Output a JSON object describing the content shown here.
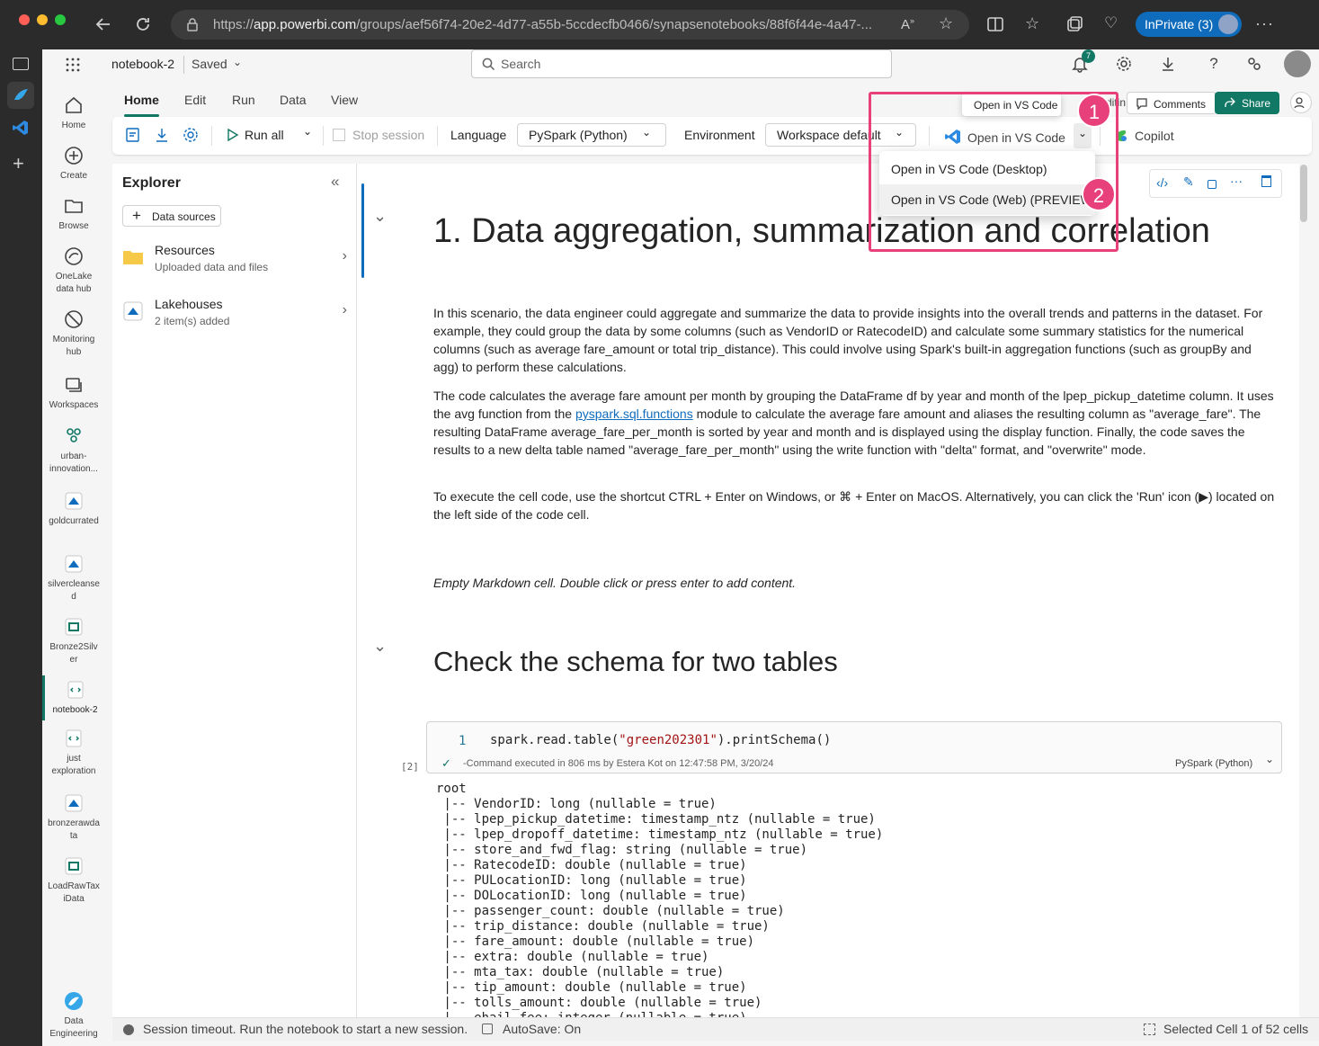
{
  "browser": {
    "url_prefix": "https://",
    "url_host": "app.powerbi.com",
    "url_path": "/groups/aef56f74-20e2-4d77-a55b-5ccdecfb0466/synapsenotebooks/88f6f44e-4a47-...",
    "inprivate_label": "InPrivate (3)"
  },
  "topbar": {
    "notebook_name": "notebook-2",
    "saved_label": "Saved",
    "search_placeholder": "Search",
    "notification_count": "7"
  },
  "nav": {
    "items": [
      {
        "label": "Home"
      },
      {
        "label": "Create"
      },
      {
        "label": "Browse"
      },
      {
        "label": "OneLake data hub"
      },
      {
        "label": "Monitoring hub"
      },
      {
        "label": "Workspaces"
      },
      {
        "label": "urban-innovation..."
      },
      {
        "label": "goldcurrated"
      },
      {
        "label": "silvercleansed"
      },
      {
        "label": "Bronze2Silver"
      },
      {
        "label": "notebook-2"
      },
      {
        "label": "just exploration"
      },
      {
        "label": "bronzerawdata"
      },
      {
        "label": "LoadRawTaxiData"
      }
    ],
    "footer_label": "Data Engineering"
  },
  "ribbon": {
    "tabs": [
      "Home",
      "Edit",
      "Run",
      "Data",
      "View"
    ],
    "editing_label": "ditin",
    "comments_label": "Comments",
    "share_label": "Share",
    "run_all_label": "Run all",
    "stop_session_label": "Stop session",
    "language_label": "Language",
    "language_value": "PySpark (Python)",
    "environment_label": "Environment",
    "environment_value": "Workspace default",
    "vscode_label": "Open in VS Code",
    "copilot_label": "Copilot",
    "tooltip": "Open in VS Code"
  },
  "dropdown": {
    "items": [
      "Open in VS Code (Desktop)",
      "Open in VS Code (Web) (PREVIEW)"
    ]
  },
  "annotations": {
    "badge1": "1",
    "badge2": "2",
    "color": "#e8407b"
  },
  "explorer": {
    "title": "Explorer",
    "data_sources_label": "Data sources",
    "items": [
      {
        "title": "Resources",
        "subtitle": "Uploaded data and files"
      },
      {
        "title": "Lakehouses",
        "subtitle": "2 item(s) added"
      }
    ]
  },
  "notebook": {
    "heading1": "1. Data aggregation, summarization and correlation",
    "para1": "In this scenario, the data engineer could aggregate and summarize the data to provide insights into the overall trends and patterns in the dataset. For example, they could group the data by some columns (such as VendorID or RatecodeID) and calculate some summary statistics for the numerical columns (such as average fare_amount or total trip_distance). This could involve using Spark's built-in aggregation functions (such as groupBy and agg) to perform these calculations.",
    "para2_a": "The code calculates the average fare amount per month by grouping the DataFrame df by year and month of the lpep_pickup_datetime column. It uses the avg function from the ",
    "para2_link": "pyspark.sql.functions",
    "para2_b": " module to calculate the average fare amount and aliases the resulting column as \"average_fare\". The resulting DataFrame average_fare_per_month is sorted by year and month and is displayed using the display function. Finally, the code saves the results to a new delta table named \"average_fare_per_month\" using the write function with \"delta\" format, and \"overwrite\" mode.",
    "para3": "To execute the cell code, use the shortcut CTRL + Enter on Windows, or ⌘ + Enter on MacOS. Alternatively, you can click the 'Run' icon (▶) located on the left side of the code cell.",
    "empty_md": "Empty Markdown cell. Double click or press enter to add content.",
    "heading2": "Check the schema for two tables",
    "code_line_no": "1",
    "code_pre": "spark.read.table(",
    "code_str": "\"green202301\"",
    "code_post": ").printSchema()",
    "exec_count": "[2]",
    "exec_status": "-Command executed in 806 ms by Estera Kot on 12:47:58 PM, 3/20/24",
    "cell_language": "PySpark (Python)",
    "output": "root\n |-- VendorID: long (nullable = true)\n |-- lpep_pickup_datetime: timestamp_ntz (nullable = true)\n |-- lpep_dropoff_datetime: timestamp_ntz (nullable = true)\n |-- store_and_fwd_flag: string (nullable = true)\n |-- RatecodeID: double (nullable = true)\n |-- PULocationID: long (nullable = true)\n |-- DOLocationID: long (nullable = true)\n |-- passenger_count: double (nullable = true)\n |-- trip_distance: double (nullable = true)\n |-- fare_amount: double (nullable = true)\n |-- extra: double (nullable = true)\n |-- mta_tax: double (nullable = true)\n |-- tip_amount: double (nullable = true)\n |-- tolls_amount: double (nullable = true)\n |-- ehail_fee: integer (nullable = true)"
  },
  "status": {
    "session": "Session timeout. Run the notebook to start a new session.",
    "autosave": "AutoSave: On",
    "selected": "Selected Cell 1 of 52 cells"
  },
  "colors": {
    "accent": "#117865",
    "highlight": "#e8407b",
    "link": "#0f6cbd"
  }
}
